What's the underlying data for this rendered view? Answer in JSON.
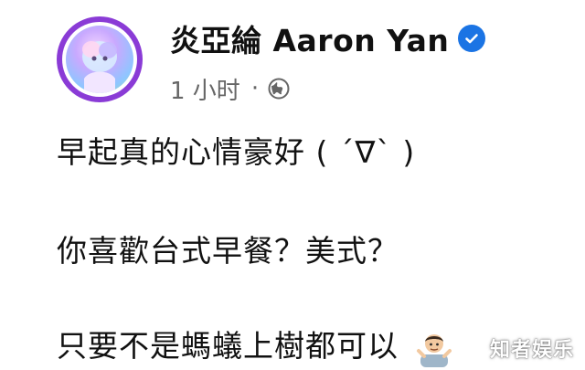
{
  "post": {
    "author": "炎亞綸 Aaron Yan",
    "timestamp": "1 小时",
    "separator": "·",
    "lines": [
      "早起真的心情豪好 ( ˊ∇ˋ )",
      "你喜歡台式早餐？美式？",
      "只要不是螞蟻上樹都可以"
    ]
  },
  "icons": {
    "verified": "verified-badge-icon",
    "audience": "globe-icon",
    "emoji": "person-shrugging-emoji"
  },
  "colors": {
    "verified": "#1b74e4",
    "avatar_ring": "#8a3bd6",
    "meta_text": "#666666"
  },
  "watermark": {
    "text": "知者娱乐"
  }
}
